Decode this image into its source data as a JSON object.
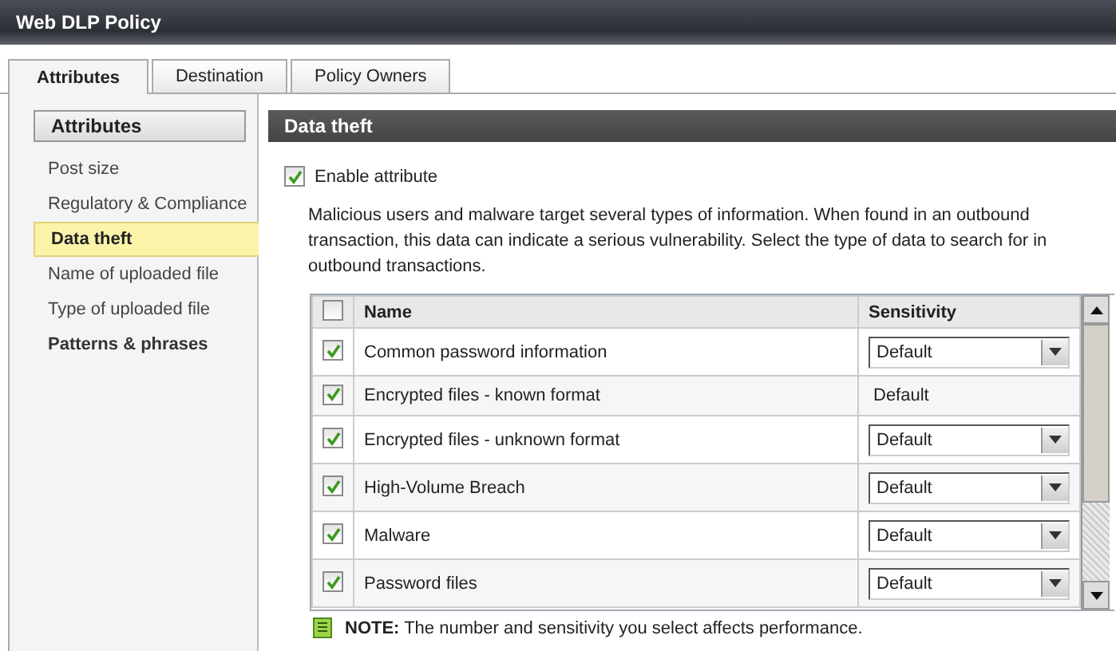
{
  "window": {
    "title": "Web DLP Policy"
  },
  "tabs": [
    {
      "label": "Attributes",
      "selected": true
    },
    {
      "label": "Destination",
      "selected": false
    },
    {
      "label": "Policy Owners",
      "selected": false
    }
  ],
  "sidebar": {
    "title": "Attributes",
    "items": [
      {
        "label": "Post size",
        "kind": "item",
        "selected": false
      },
      {
        "label": "Regulatory & Compliance",
        "kind": "item",
        "selected": false
      },
      {
        "label": "Data theft",
        "kind": "item",
        "selected": true
      },
      {
        "label": "Name of uploaded file",
        "kind": "item",
        "selected": false
      },
      {
        "label": "Type of uploaded file",
        "kind": "item",
        "selected": false
      },
      {
        "label": "Patterns & phrases",
        "kind": "group",
        "selected": false
      }
    ]
  },
  "panel": {
    "title": "Data theft",
    "enable": {
      "label": "Enable attribute",
      "checked": true
    },
    "description": "Malicious users and malware target several types of information. When found in an outbound transaction,  this data can indicate a serious vulnerability. Select the type of data to search for in outbound transactions.",
    "table": {
      "columns": [
        "Name",
        "Sensitivity"
      ],
      "all_checked": false,
      "rows": [
        {
          "checked": true,
          "name": "Common password information",
          "kind": "select",
          "sensitivity": "Default"
        },
        {
          "checked": true,
          "name": "Encrypted files - known format",
          "kind": "text",
          "sensitivity": "Default"
        },
        {
          "checked": true,
          "name": "Encrypted files - unknown format",
          "kind": "select",
          "sensitivity": "Default"
        },
        {
          "checked": true,
          "name": "High-Volume Breach",
          "kind": "select",
          "sensitivity": "Default"
        },
        {
          "checked": true,
          "name": "Malware",
          "kind": "select",
          "sensitivity": "Default"
        },
        {
          "checked": true,
          "name": "Password files",
          "kind": "select",
          "sensitivity": "Default"
        }
      ]
    },
    "note": "**NOTE:** The number and sensitivity you select affects performance."
  }
}
